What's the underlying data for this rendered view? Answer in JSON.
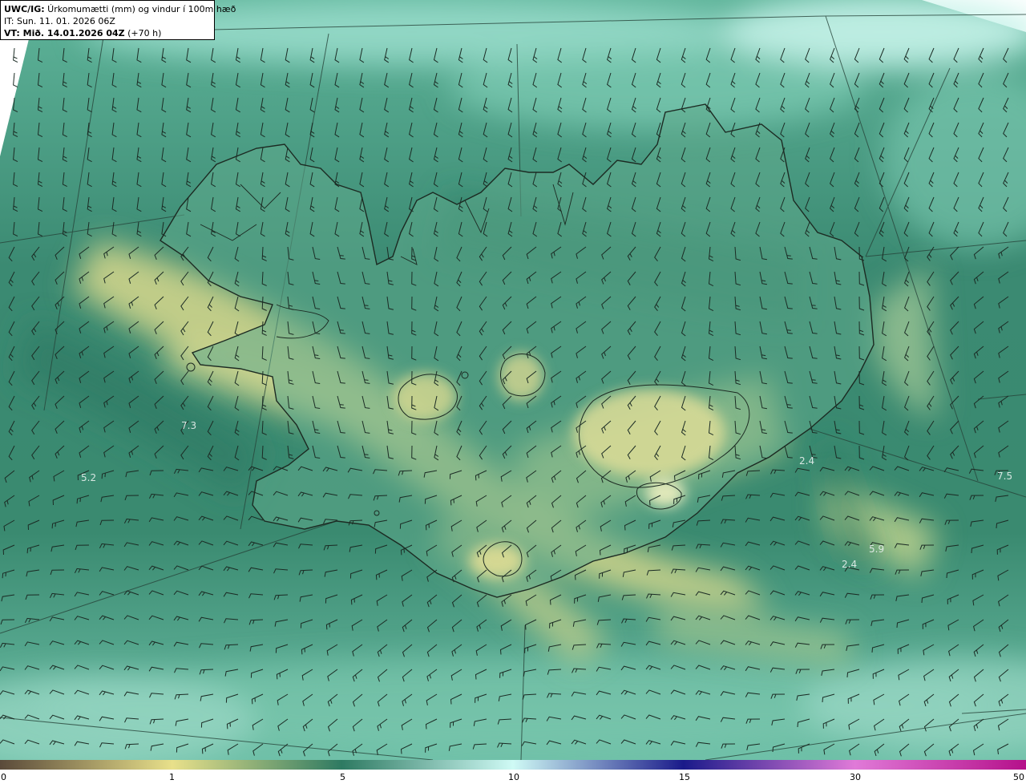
{
  "header": {
    "line1_bold": "UWC/IG:",
    "line1_rest": " Úrkomumætti (mm) og vindur í 100m hæð",
    "line2": "IT: Sun. 11. 01. 2026 06Z",
    "line3_bold": "VT: Mið. 14.01.2026 04Z",
    "line3_rest": " (+70 h)"
  },
  "map_values": [
    {
      "id": "val-1",
      "text": "7.3"
    },
    {
      "id": "val-2",
      "text": "5.2"
    },
    {
      "id": "val-3",
      "text": "2.4"
    },
    {
      "id": "val-4",
      "text": "7.5"
    },
    {
      "id": "val-5",
      "text": "5.9"
    },
    {
      "id": "val-6",
      "text": "2.4"
    }
  ],
  "legend": {
    "ticks": [
      "0",
      "1",
      "5",
      "10",
      "15",
      "30",
      "50"
    ],
    "stops": [
      {
        "value": "0",
        "color": "#5a4a3a"
      },
      {
        "value": "1",
        "color": "#e8e08a"
      },
      {
        "value": "5",
        "color": "#2e7a62"
      },
      {
        "value": "10",
        "color": "#cffaf5"
      },
      {
        "value": "15",
        "color": "#1a1a8a"
      },
      {
        "value": "30",
        "color": "#e07ad8"
      },
      {
        "value": "50",
        "color": "#b5108a"
      }
    ]
  },
  "colors": {
    "sea_dark": "#2f7c66",
    "sea_mid": "#4b9a80",
    "band_light": "#c7d890",
    "band_yellow": "#d8d98a",
    "ice_light": "#b9ecdf",
    "coast": "#1c2a22",
    "barb": "#1b2b24"
  }
}
